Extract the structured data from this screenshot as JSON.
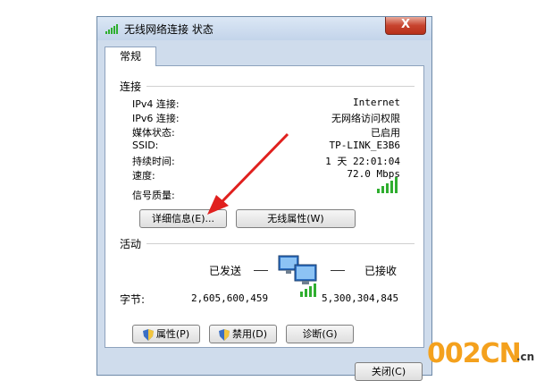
{
  "window": {
    "title": "无线网络连接 状态",
    "close_glyph": "X"
  },
  "tabs": [
    {
      "label": "常规"
    }
  ],
  "connection": {
    "section_title": "连接",
    "rows": [
      {
        "label": "IPv4 连接:",
        "value": "Internet"
      },
      {
        "label": "IPv6 连接:",
        "value": "无网络访问权限"
      },
      {
        "label": "媒体状态:",
        "value": "已启用"
      },
      {
        "label": "SSID:",
        "value": "TP-LINK_E3B6"
      },
      {
        "label": "持续时间:",
        "value": "1 天 22:01:04"
      },
      {
        "label": "速度:",
        "value": "72.0 Mbps"
      }
    ],
    "signal_label": "信号质量:",
    "signal_bars": 5,
    "details_button": "详细信息(E)...",
    "wireless_props_button": "无线属性(W)"
  },
  "activity": {
    "section_title": "活动",
    "sent_label": "已发送",
    "received_label": "已接收",
    "bytes_label": "字节:",
    "bytes_sent": "2,605,600,459",
    "bytes_received": "5,300,304,845"
  },
  "buttons": {
    "properties": "属性(P)",
    "disable": "禁用(D)",
    "diagnose": "诊断(G)",
    "close": "关闭(C)"
  },
  "watermark": {
    "brand": "002CN",
    "suffix": ".cn"
  },
  "colors": {
    "accent_arrow": "#e0201e",
    "signal_green": "#2fae2f",
    "window_frame": "#cfdcec"
  }
}
